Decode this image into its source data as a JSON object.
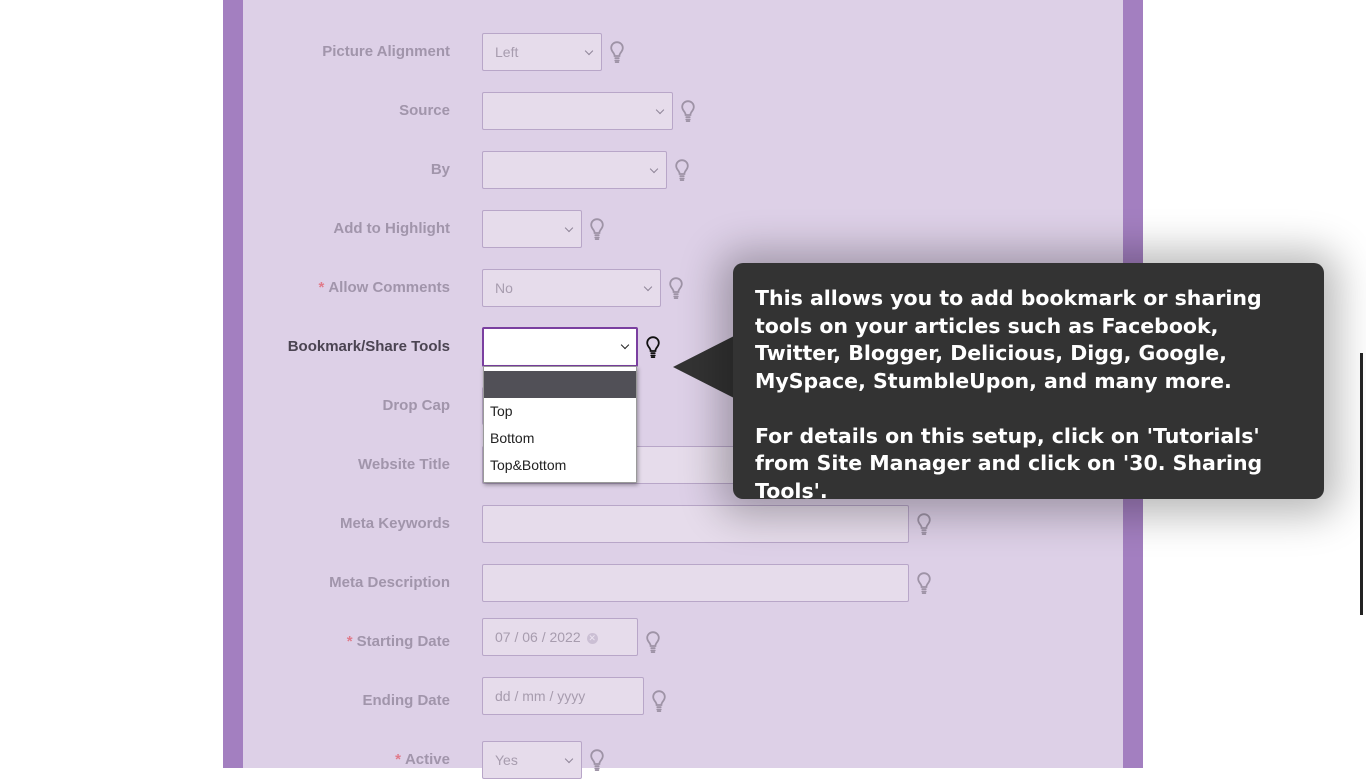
{
  "form": {
    "fields": [
      {
        "label": "Picture Alignment",
        "value": "Left",
        "type": "select"
      },
      {
        "label": "Source",
        "value": "",
        "type": "select"
      },
      {
        "label": "By",
        "value": "",
        "type": "select"
      },
      {
        "label": "Add to Highlight",
        "value": "",
        "type": "select"
      },
      {
        "label": "Allow Comments",
        "value": "No",
        "type": "select",
        "required": "*"
      },
      {
        "label": "Bookmark/Share Tools",
        "value": "",
        "type": "select"
      },
      {
        "label": "Drop Cap",
        "value": "",
        "type": "select"
      },
      {
        "label": "Website Title",
        "value": "",
        "type": "text"
      },
      {
        "label": "Meta Keywords",
        "value": "",
        "type": "text"
      },
      {
        "label": "Meta Description",
        "value": "",
        "type": "text"
      },
      {
        "label": "Starting Date",
        "value": "07 / 06 / 2022",
        "type": "date",
        "required": "*"
      },
      {
        "label": "Ending Date",
        "value": "dd / mm / yyyy",
        "type": "date"
      },
      {
        "label": "Active",
        "value": "Yes",
        "type": "select",
        "required": "*"
      }
    ]
  },
  "dropdown": {
    "options": [
      "",
      "Top",
      "Bottom",
      "Top&Bottom"
    ]
  },
  "tooltip": {
    "paragraph1": "This allows you to add bookmark or sharing tools on your articles such as Facebook, Twitter, Blogger, Delicious, Digg, Google, MySpace, StumbleUpon, and many more.",
    "paragraph2": "For details on this setup, click on 'Tutorials' from Site Manager and click on '30. Sharing Tools'."
  },
  "icons": {
    "help": "lightbulb-icon",
    "clear": "clear-date-icon",
    "dropdown": "chevron-down-icon"
  },
  "colors": {
    "frame": "#a37fc0",
    "panel": "#ddd0e7",
    "tooltip": "#333333",
    "focus": "#7a3fa0"
  }
}
